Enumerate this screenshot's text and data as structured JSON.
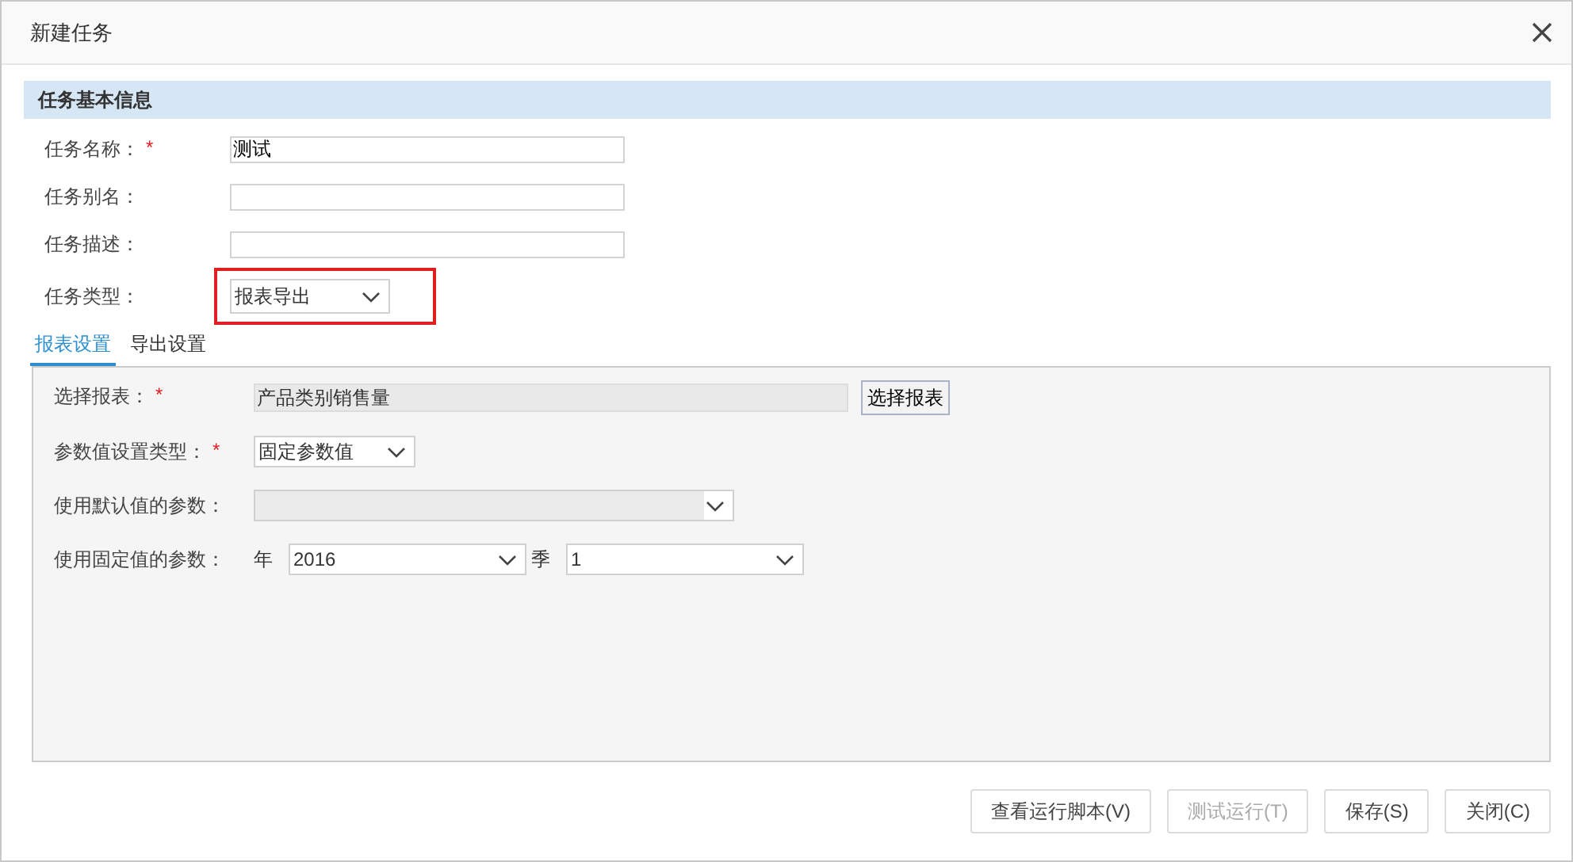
{
  "window": {
    "title": "新建任务"
  },
  "section": {
    "title": "任务基本信息"
  },
  "fields": [
    {
      "label": "任务名称：",
      "mark": "*",
      "kind": "text",
      "value": "测试",
      "highlighted": false
    },
    {
      "label": "任务别名：",
      "kind": "text",
      "highlighted": false
    },
    {
      "label": "任务描述：",
      "kind": "text",
      "highlighted": false
    },
    {
      "label": "任务类型：",
      "kind": "select",
      "value": "报表导出",
      "highlighted": true
    }
  ],
  "tabs": [
    {
      "label": "报表设置",
      "selected": true
    },
    {
      "label": "导出设置",
      "selected": false
    }
  ],
  "settings": [
    {
      "label": "选择报表：",
      "mark": "*",
      "kind": "picker",
      "value": "产品类别销售量",
      "button": "选择报表"
    },
    {
      "label": "参数值设置类型：",
      "mark": "*",
      "kind": "select",
      "value": "固定参数值"
    },
    {
      "label": "使用默认值的参数：",
      "kind": "disabled-select"
    },
    {
      "label": "使用固定值的参数：",
      "kind": "params",
      "params": [
        {
          "name": "年",
          "value": "2016"
        },
        {
          "name": "季",
          "value": "1"
        }
      ]
    }
  ],
  "buttons": [
    {
      "label": "查看运行脚本(V)",
      "disabled": false
    },
    {
      "label": "测试运行(T)",
      "disabled": true
    },
    {
      "label": "保存(S)",
      "disabled": false
    },
    {
      "label": "关闭(C)",
      "disabled": false
    }
  ]
}
